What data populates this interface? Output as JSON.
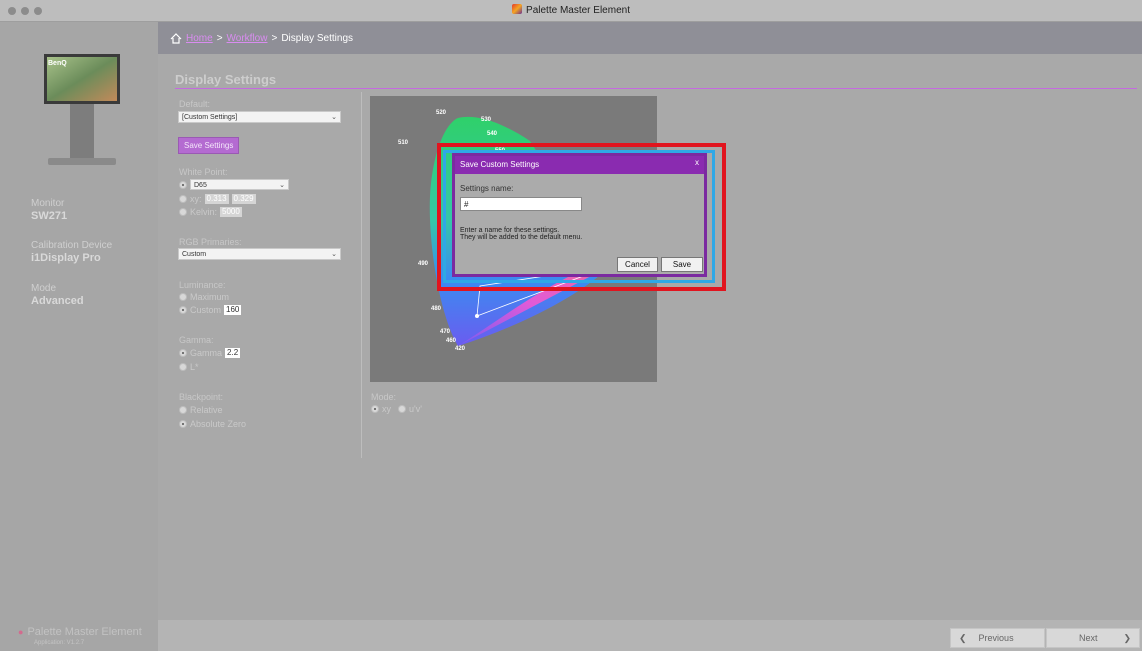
{
  "window": {
    "title": "Palette Master Element"
  },
  "breadcrumb": {
    "home": "Home",
    "workflow": "Workflow",
    "current": "Display Settings",
    "sep": ">"
  },
  "page": {
    "title": "Display Settings"
  },
  "sidebar": {
    "monitor_label": "Monitor",
    "monitor_value": "SW271",
    "device_label": "Calibration Device",
    "device_value": "i1Display Pro",
    "mode_label": "Mode",
    "mode_value": "Advanced",
    "brand": "Palette Master Element",
    "app_version": "Application: V1.2.7"
  },
  "settings": {
    "default_label": "Default:",
    "default_value": "[Custom Settings]",
    "save_settings": "Save Settings",
    "white_point_label": "White Point:",
    "white_point_value": "D65",
    "xy_label": "xy:",
    "xy_x": "0.313",
    "xy_y": "0.329",
    "kelvin_label": "Kelvin:",
    "kelvin_value": "5000",
    "rgb_label": "RGB Primaries:",
    "rgb_value": "Custom",
    "luminance_label": "Luminance:",
    "lum_max": "Maximum",
    "lum_custom": "Custom",
    "lum_value": "160",
    "gamma_label": "Gamma:",
    "gamma_opt": "Gamma",
    "gamma_value": "2.2",
    "lstar": "L*",
    "blackpoint_label": "Blackpoint:",
    "bp_relative": "Relative",
    "bp_absolute": "Absolute Zero",
    "mode_label": "Mode:",
    "mode_xy": "xy",
    "mode_uv": "u'v'"
  },
  "chart_labels": [
    "520",
    "530",
    "540",
    "510",
    "550",
    "490",
    "480",
    "470",
    "460",
    "420"
  ],
  "dialog": {
    "title": "Save Custom Settings",
    "close": "x",
    "field_label": "Settings name:",
    "field_value": "#",
    "msg1": "Enter a name for these settings.",
    "msg2": "They will be added to the default menu.",
    "cancel": "Cancel",
    "save": "Save"
  },
  "nav": {
    "previous": "Previous",
    "next": "Next"
  },
  "colors": {
    "accent": "#8a2bb0",
    "highlight": "#e1141e",
    "link": "#d98cf0"
  }
}
